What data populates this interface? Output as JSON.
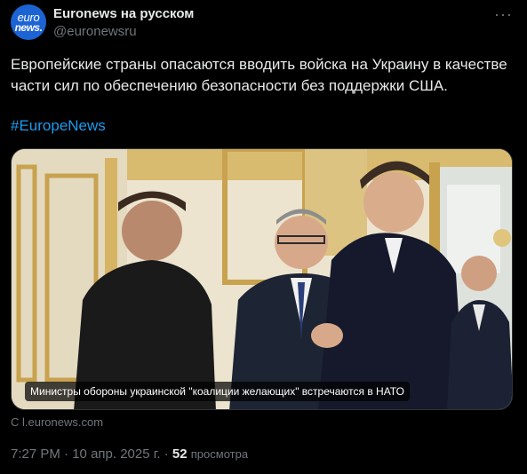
{
  "author": {
    "name": "Euronews на русском",
    "handle": "@euronewsru",
    "avatar_line1": "euro",
    "avatar_line2": "news."
  },
  "more_icon": "more-dots-icon",
  "tweet": {
    "text": "Европейские страны опасаются вводить войска на Украину в качестве части сил по обеспечению безопасности без поддержки США.",
    "hashtag": "#EuropeNews"
  },
  "card": {
    "caption": "Министры обороны украинской \"коалиции желающих\" встречаются в НАТО",
    "source": "С l.euronews.com"
  },
  "meta": {
    "time": "7:27 PM",
    "separator": "·",
    "date": "10 апр. 2025 г.",
    "views": "52",
    "views_label": "просмотра"
  },
  "colors": {
    "background": "#000000",
    "text": "#e7e9ea",
    "muted": "#71767b",
    "link": "#1d9bf0",
    "avatar": "#1c64d4"
  }
}
